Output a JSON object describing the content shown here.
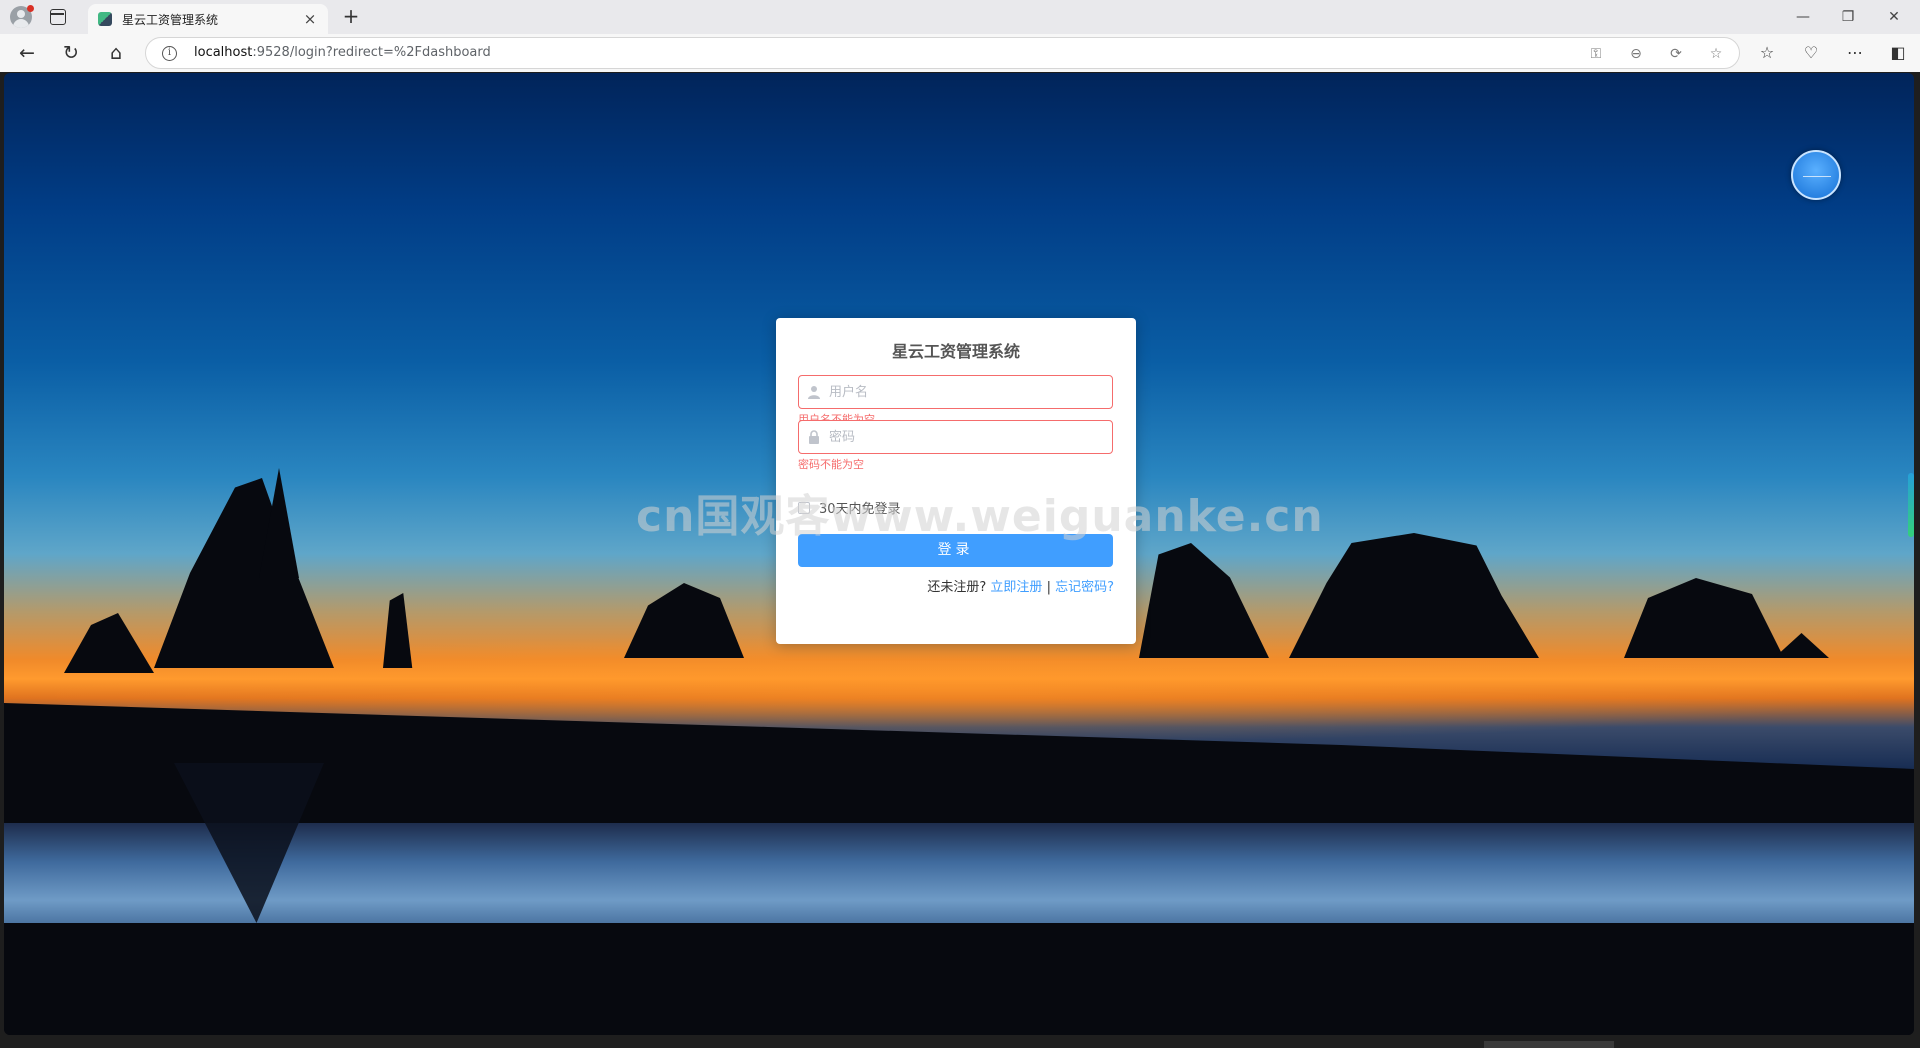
{
  "browser": {
    "tab_title": "星云工资管理系统",
    "tab_close": "×",
    "new_tab": "+",
    "url_host": "localhost",
    "url_rest": ":9528/login?redirect=%2Fdashboard",
    "icons": [
      "back-icon",
      "reload-icon",
      "home-icon",
      "info-icon",
      "key-icon",
      "zoom-out-icon",
      "sync-icon",
      "star-icon",
      "favorites-icon",
      "extensions-icon",
      "more-icon",
      "sidebar-icon"
    ]
  },
  "window_controls": {
    "minimize": "—",
    "restore": "❐",
    "close": "✕"
  },
  "login": {
    "title": "星云工资管理系统",
    "username_placeholder": "用户名",
    "username_error": "用户名不能为空",
    "password_placeholder": "密码",
    "password_error": "密码不能为空",
    "remember_label": "30天内免登录",
    "submit_label": "登录",
    "register_prompt": "还未注册?",
    "register_link": "立即注册",
    "separator": "|",
    "forgot_link": "忘记密码?"
  },
  "watermark": "cn国观客www.weiguanke.cn",
  "colors": {
    "accent": "#409eff",
    "error": "#f56c6c"
  }
}
